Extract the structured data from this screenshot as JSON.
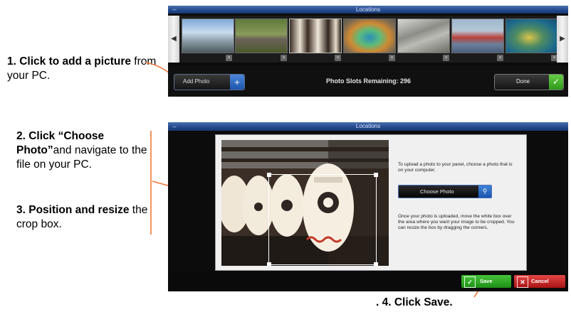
{
  "notes": {
    "step1_bold": "1. Click to add a picture",
    "step1_rest": " from your PC.",
    "step2_bold": "2. Click “Choose Photo”",
    "step2_rest": "and navigate to the file on your PC.",
    "step3_bold": "3. Position and resize",
    "step3_rest": " the crop box.",
    "step4": ". 4. Click Save."
  },
  "panel_locations": {
    "title": "Locations",
    "minimize_icon": "minus-icon",
    "prev_icon": "chevron-left-icon",
    "next_icon": "chevron-right-icon",
    "remove_icon": "close-icon",
    "remove_glyph": "×",
    "thumbnails": [
      {
        "subject": "geyser"
      },
      {
        "subject": "elephant"
      },
      {
        "subject": "lanterns"
      },
      {
        "subject": "hot spring"
      },
      {
        "subject": "rocks"
      },
      {
        "subject": "harbor town"
      },
      {
        "subject": "underwater"
      }
    ],
    "add_photo_label": "Add Photo",
    "add_icon": "plus-icon",
    "slots_text": "Photo Slots Remaining: 296",
    "done_label": "Done",
    "done_icon": "check-icon"
  },
  "panel_upload": {
    "title": "Locations",
    "instruction_top": "To upload a photo to your panel, choose a photo that is on your computer.",
    "choose_label": "Choose Photo",
    "search_icon": "search-icon",
    "instruction_bottom": "Once your photo is uploaded, move the white box over the area where you want your image to be cropped. You can resize the box by dragging the corners.",
    "save_label": "Save",
    "cancel_label": "Cancel",
    "accent_blue": "#2a63be",
    "save_green": "#2fa324",
    "cancel_red": "#c62222"
  }
}
